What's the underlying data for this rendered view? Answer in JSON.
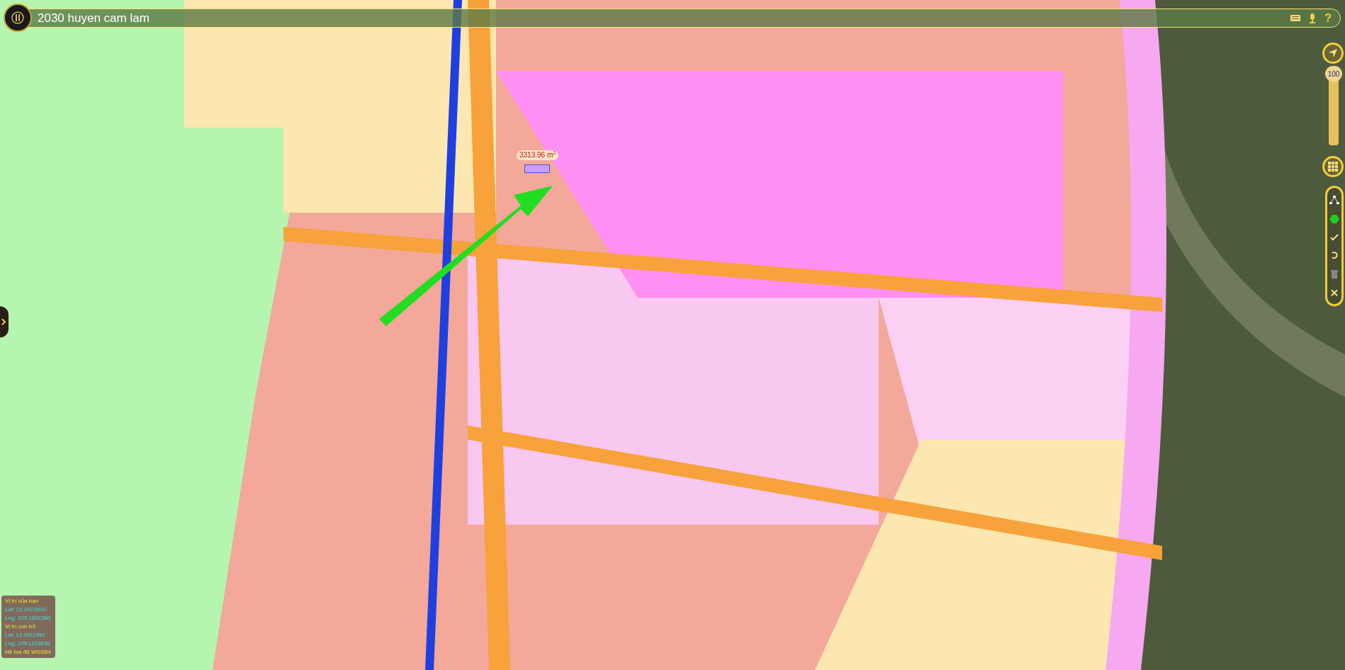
{
  "window": {
    "title": "2030 huyen cam lam"
  },
  "toolbar": {
    "help": "?"
  },
  "zoom": {
    "label": "100",
    "level": 1
  },
  "measurement": {
    "area": "3313.96 m$^{2}$"
  },
  "info_panel": [
    {
      "kind": "heading",
      "text": "Vị trí của bạn"
    },
    {
      "kind": "value",
      "text": "Lat: 12.2472010"
    },
    {
      "kind": "value",
      "text": "Lng: 109.1891580"
    },
    {
      "kind": "heading",
      "text": "Vị trí con trỏ"
    },
    {
      "kind": "value",
      "text": "Lat: 12.0011597"
    },
    {
      "kind": "value",
      "text": "Lng: 109.1119838"
    },
    {
      "kind": "heading",
      "text": "Hệ tọa độ WGS84"
    }
  ]
}
